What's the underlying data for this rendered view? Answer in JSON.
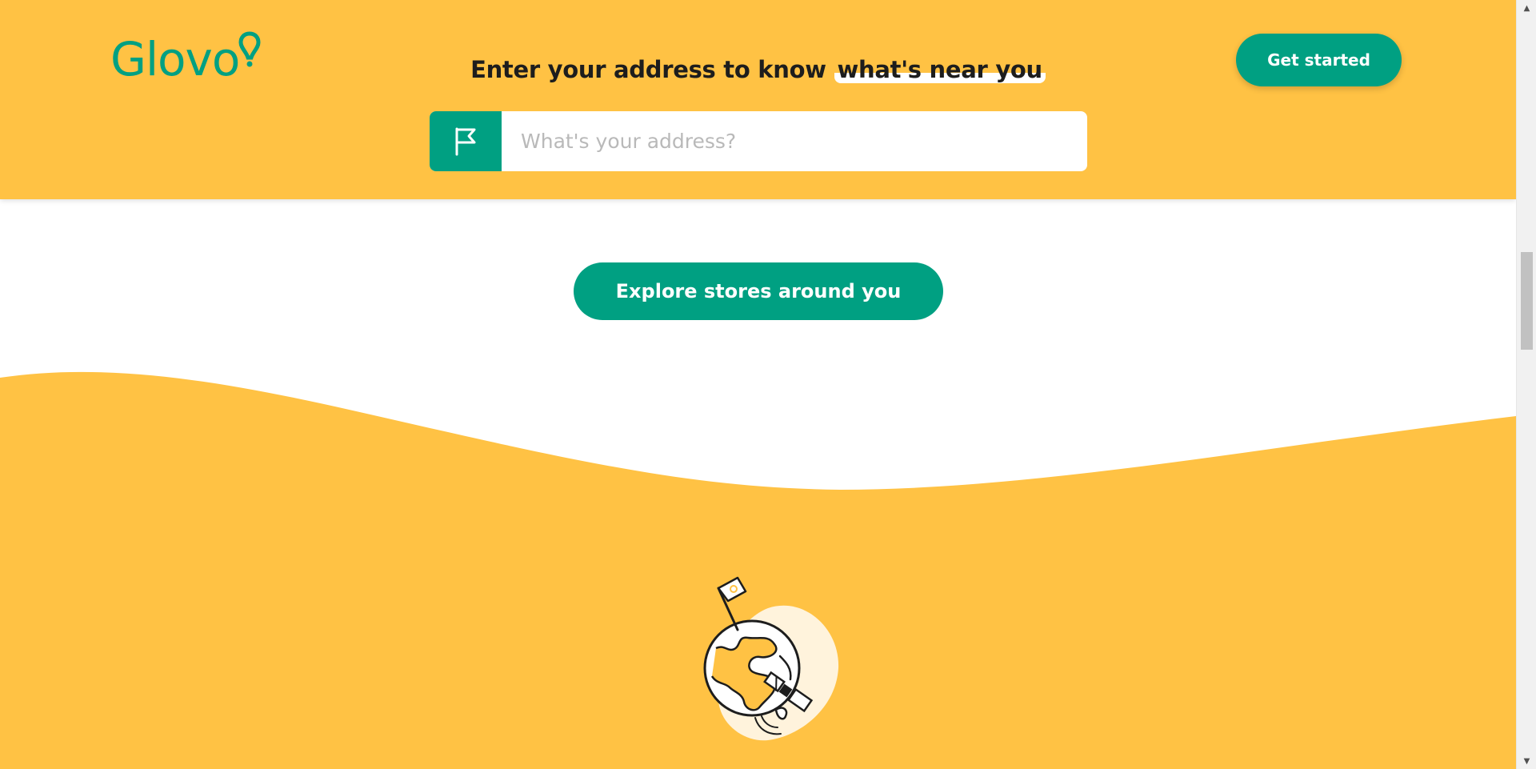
{
  "header": {
    "logo_text": "Glovo",
    "tagline_prefix": "Enter your address to know ",
    "tagline_highlight": "what's near you",
    "get_started_label": "Get started",
    "address_placeholder": "What's your address?",
    "flag_icon": "flag-icon"
  },
  "main": {
    "explore_label": "Explore stores around you",
    "illustration": "globe-with-flag-and-satellite"
  },
  "colors": {
    "brand_yellow": "#FFC244",
    "brand_green": "#00A082",
    "white": "#FFFFFF"
  }
}
